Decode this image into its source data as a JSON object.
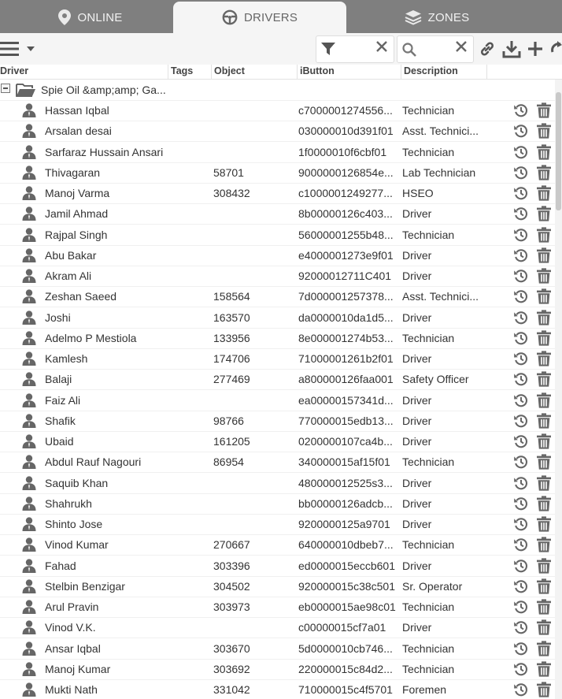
{
  "tabs": [
    {
      "label": "ONLINE",
      "icon": "map-pin-icon"
    },
    {
      "label": "DRIVERS",
      "icon": "steering-wheel-icon"
    },
    {
      "label": "ZONES",
      "icon": "layers-icon"
    }
  ],
  "active_tab": "DRIVERS",
  "toolbar": {
    "menu_icon": "hamburger-icon",
    "filter_value": "",
    "search_value": "",
    "actions": [
      "link-icon",
      "download-icon",
      "plus-icon",
      "refresh-icon"
    ]
  },
  "columns": [
    "Driver",
    "Tags",
    "Object",
    "iButton",
    "Description"
  ],
  "group": {
    "name": "Spie Oil &amp;amp; Ga..."
  },
  "rows": [
    {
      "driver": "Hassan Iqbal",
      "tags": "",
      "object": "",
      "ibutton": "c7000001274556...",
      "description": "Technician"
    },
    {
      "driver": "Arsalan desai",
      "tags": "",
      "object": "",
      "ibutton": "030000010d391f01",
      "description": "Asst. Technici..."
    },
    {
      "driver": "Sarfaraz Hussain Ansari",
      "tags": "",
      "object": "",
      "ibutton": "1f0000010f6cbf01",
      "description": "Technician"
    },
    {
      "driver": "Thivagaran",
      "tags": "",
      "object": "58701",
      "ibutton": "9000000126854e...",
      "description": "Lab Technician"
    },
    {
      "driver": "Manoj Varma",
      "tags": "",
      "object": "308432",
      "ibutton": "c1000001249277...",
      "description": "HSEO"
    },
    {
      "driver": "Jamil Ahmad",
      "tags": "",
      "object": "",
      "ibutton": "8b00000126c403...",
      "description": "Driver"
    },
    {
      "driver": "Rajpal Singh",
      "tags": "",
      "object": "",
      "ibutton": "56000001255b48...",
      "description": "Technician"
    },
    {
      "driver": "Abu Bakar",
      "tags": "",
      "object": "",
      "ibutton": "e4000001273e9f01",
      "description": "Driver"
    },
    {
      "driver": "Akram Ali",
      "tags": "",
      "object": "",
      "ibutton": "92000012711C401",
      "description": "Driver"
    },
    {
      "driver": "Zeshan Saeed",
      "tags": "",
      "object": "158564",
      "ibutton": "7d000001257378...",
      "description": "Asst. Technici..."
    },
    {
      "driver": "Joshi",
      "tags": "",
      "object": "163570",
      "ibutton": "da0000010da1d5...",
      "description": "Driver"
    },
    {
      "driver": "Adelmo P Mestiola",
      "tags": "",
      "object": "133956",
      "ibutton": "8e000001274b53...",
      "description": "Technician"
    },
    {
      "driver": "Kamlesh",
      "tags": "",
      "object": "174706",
      "ibutton": "71000001261b2f01",
      "description": "Driver"
    },
    {
      "driver": "Balaji",
      "tags": "",
      "object": "277469",
      "ibutton": "a800000126faa001",
      "description": "Safety Officer"
    },
    {
      "driver": "Faiz Ali",
      "tags": "",
      "object": "",
      "ibutton": "ea00000157341d...",
      "description": "Driver"
    },
    {
      "driver": "Shafik",
      "tags": "",
      "object": "98766",
      "ibutton": "770000015edb13...",
      "description": "Driver"
    },
    {
      "driver": "Ubaid",
      "tags": "",
      "object": "161205",
      "ibutton": "0200000107ca4b...",
      "description": "Driver"
    },
    {
      "driver": "Abdul Rauf Nagouri",
      "tags": "",
      "object": "86954",
      "ibutton": "340000015af15f01",
      "description": "Technician"
    },
    {
      "driver": "Saquib Khan",
      "tags": "",
      "object": "",
      "ibutton": "480000012525s3...",
      "description": "Driver"
    },
    {
      "driver": "Shahrukh",
      "tags": "",
      "object": "",
      "ibutton": "bb00000126adcb...",
      "description": "Driver"
    },
    {
      "driver": "Shinto Jose",
      "tags": "",
      "object": "",
      "ibutton": "9200000125a9701",
      "description": "Driver"
    },
    {
      "driver": "Vinod Kumar",
      "tags": "",
      "object": "270667",
      "ibutton": "640000010dbeb7...",
      "description": "Technician"
    },
    {
      "driver": "Fahad",
      "tags": "",
      "object": "303396",
      "ibutton": "ed0000015eccb601",
      "description": "Driver"
    },
    {
      "driver": "Stelbin Benzigar",
      "tags": "",
      "object": "304502",
      "ibutton": "920000015c38c501",
      "description": "Sr. Operator"
    },
    {
      "driver": "Arul Pravin",
      "tags": "",
      "object": "303973",
      "ibutton": "eb0000015ae98c01",
      "description": "Technician"
    },
    {
      "driver": "Vinod V.K.",
      "tags": "",
      "object": "",
      "ibutton": "c00000015cf7a01",
      "description": "Driver"
    },
    {
      "driver": "Ansar Iqbal",
      "tags": "",
      "object": "303670",
      "ibutton": "5d0000010cb746...",
      "description": "Technician"
    },
    {
      "driver": "Manoj Kumar",
      "tags": "",
      "object": "303692",
      "ibutton": "220000015c84d2...",
      "description": "Technician"
    },
    {
      "driver": "Mukti Nath",
      "tags": "",
      "object": "331042",
      "ibutton": "710000015c4f5701",
      "description": "Foremen"
    }
  ],
  "row_actions": [
    "history-icon",
    "trash-icon"
  ],
  "colors": {
    "tab_bar": "#7f7f7f",
    "active_tab": "#f5f5f5",
    "icon_gray": "#555555"
  }
}
